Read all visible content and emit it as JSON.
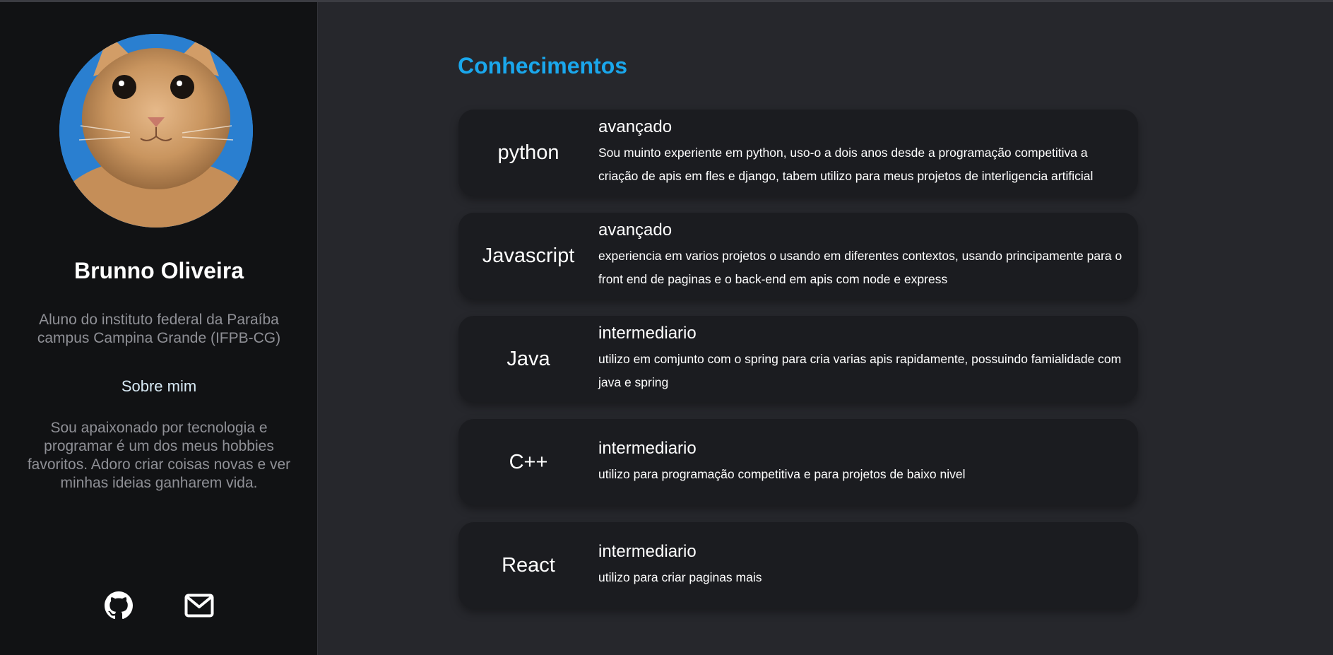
{
  "profile": {
    "name": "Brunno Oliveira",
    "description": "Aluno do instituto federal da Paraíba campus Campina Grande (IFPB-CG)",
    "about_link": "Sobre mim",
    "about_text": "Sou apaixonado por tecnologia e programar é um dos meus hobbies favoritos. Adoro criar coisas novas e ver minhas ideias ganharem vida.",
    "avatar_icon": "cat-photo",
    "social": [
      {
        "icon": "github-icon"
      },
      {
        "icon": "mail-icon"
      }
    ]
  },
  "main": {
    "title": "Conhecimentos",
    "skills": [
      {
        "name": "python",
        "level": "avançado",
        "description": "Sou muinto experiente em python, uso-o a dois anos desde a programação competitiva a criação de apis em fles e django, tabem utilizo para meus projetos de interligencia artificial"
      },
      {
        "name": "Javascript",
        "level": "avançado",
        "description": "experiencia em varios projetos o usando em diferentes contextos, usando principamente para o front end de paginas e o back-end em apis com node e express"
      },
      {
        "name": "Java",
        "level": "intermediario",
        "description": "utilizo em comjunto com o spring para cria varias apis rapidamente, possuindo famialidade com java e spring"
      },
      {
        "name": "C++",
        "level": "intermediario",
        "description": "utilizo para programação competitiva e para projetos de baixo nivel"
      },
      {
        "name": "React",
        "level": "intermediario",
        "description": "utilizo para criar paginas mais"
      }
    ]
  },
  "colors": {
    "accent": "#1aa7ec",
    "sidebar_bg": "#111214",
    "main_bg": "#26272c",
    "card_bg": "#1b1c20"
  }
}
